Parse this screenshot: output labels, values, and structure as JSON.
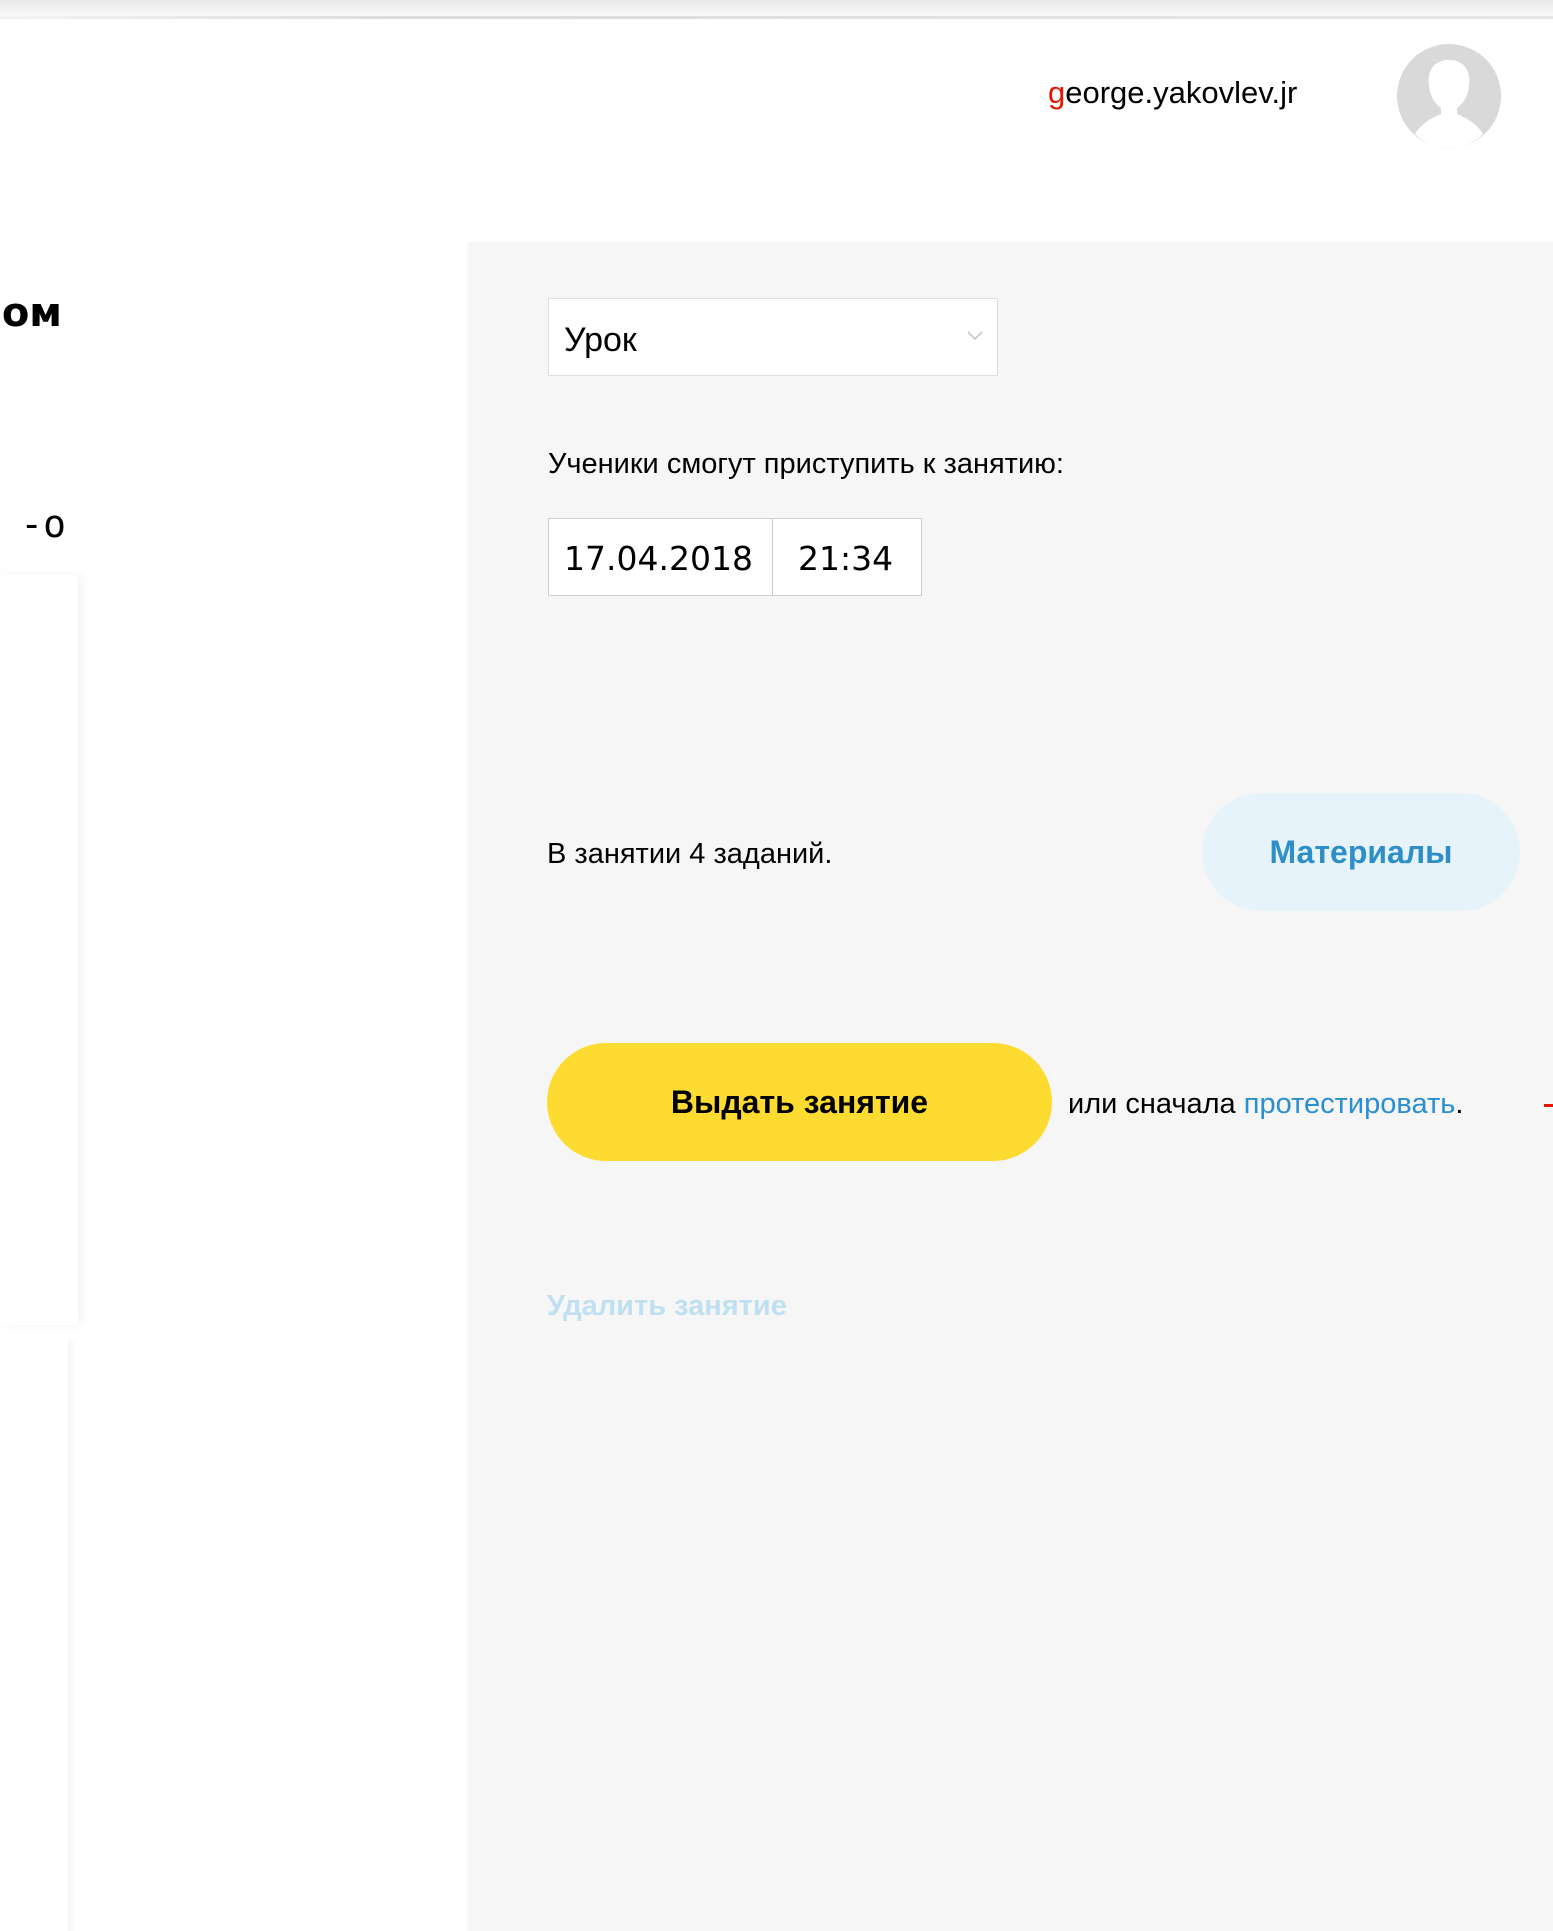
{
  "header": {
    "username_first": "g",
    "username_rest": "eorge.yakovlev.jr",
    "avatar_icon": "user-avatar-icon"
  },
  "left_column": {
    "heading_fragment": "ом",
    "text_fragment": "о-"
  },
  "form": {
    "lesson_type": {
      "selected": "Урок",
      "icon": "chevron-down-icon"
    },
    "start_label": "Ученики смогут приступить к занятию:",
    "start_date": "17.04.2018",
    "start_time": "21:34",
    "tasks_text": "В занятии 4 заданий.",
    "materials_button": "Материалы",
    "issue_button": "Выдать занятие",
    "or_text": "или сначала ",
    "test_link": "протестировать",
    "period": ".",
    "delete_link": "Удалить занятие"
  },
  "colors": {
    "accent_yellow": "#fedb30",
    "link_blue": "#2a8fd0",
    "materials_bg": "#e6f3fa",
    "materials_text": "#2d8fc5",
    "brand_red": "#e61400",
    "panel_bg": "#f6f6f6",
    "delete_disabled": "#bfe0f0"
  }
}
